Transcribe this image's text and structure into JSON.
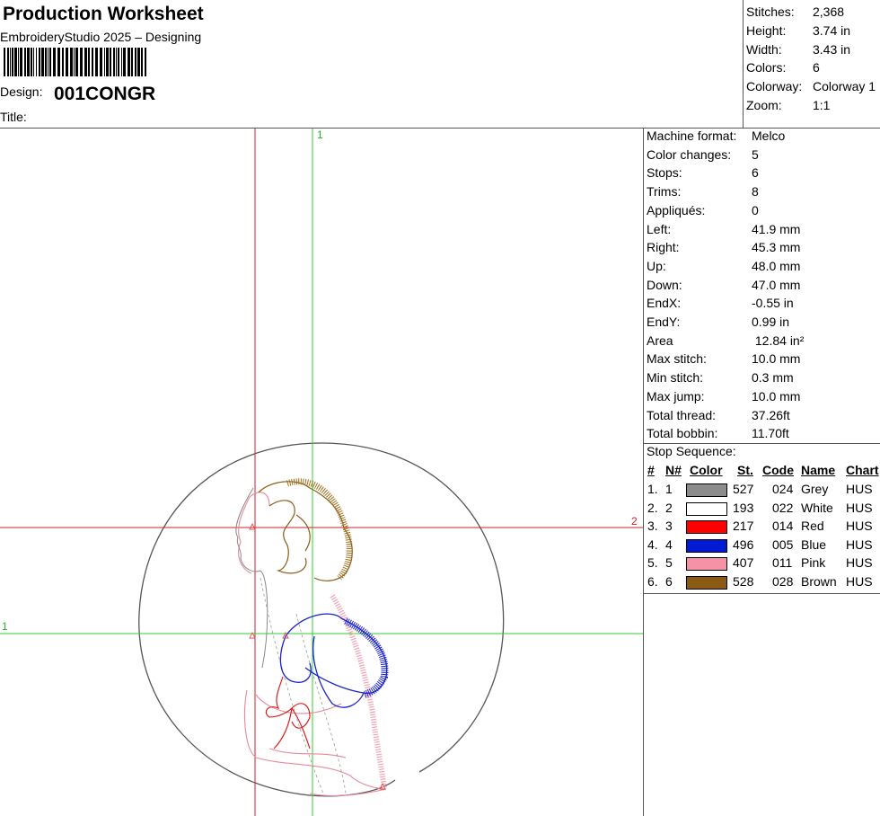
{
  "header": {
    "title": "Production Worksheet",
    "subtitle": "EmbroideryStudio 2025 – Designing",
    "design_label": "Design:",
    "design_value": "001CONGR",
    "title_label": "Title:"
  },
  "summary": [
    {
      "label": "Stitches:",
      "value": "2,368"
    },
    {
      "label": "Height:",
      "value": "3.74 in"
    },
    {
      "label": "Width:",
      "value": "3.43 in"
    },
    {
      "label": "Colors:",
      "value": "6"
    },
    {
      "label": "Colorway:",
      "value": "Colorway 1"
    },
    {
      "label": "Zoom:",
      "value": "1:1"
    }
  ],
  "details": [
    {
      "label": "Machine format:",
      "value": "Melco"
    },
    {
      "label": "Color changes:",
      "value": "5"
    },
    {
      "label": "Stops:",
      "value": "6"
    },
    {
      "label": "Trims:",
      "value": "8"
    },
    {
      "label": "Appliqués:",
      "value": "0"
    },
    {
      "label": "Left:",
      "value": "41.9 mm"
    },
    {
      "label": "Right:",
      "value": "45.3 mm"
    },
    {
      "label": "Up:",
      "value": "48.0 mm"
    },
    {
      "label": "Down:",
      "value": "47.0 mm"
    },
    {
      "label": "EndX:",
      "value": "-0.55 in"
    },
    {
      "label": "EndY:",
      "value": "0.99 in"
    },
    {
      "label": "Area",
      "value": " 12.84 in²"
    },
    {
      "label": "Max stitch:",
      "value": "10.0 mm"
    },
    {
      "label": "Min stitch:",
      "value": "0.3 mm"
    },
    {
      "label": "Max jump:",
      "value": "10.0 mm"
    },
    {
      "label": "Total thread:",
      "value": "37.26ft"
    },
    {
      "label": "Total bobbin:",
      "value": "11.70ft"
    }
  ],
  "stop_sequence": {
    "title": "Stop Sequence:",
    "headers": [
      "#",
      "N#",
      "Color",
      "St.",
      "Code",
      "Name",
      "Chart"
    ],
    "rows": [
      {
        "idx": "1.",
        "n": "1",
        "color": "#8c8c8c",
        "st": "527",
        "code": "024",
        "name": "Grey",
        "chart": "HUS"
      },
      {
        "idx": "2.",
        "n": "2",
        "color": "#ffffff",
        "st": "193",
        "code": "022",
        "name": "White",
        "chart": "HUS"
      },
      {
        "idx": "3.",
        "n": "3",
        "color": "#ff0000",
        "st": "217",
        "code": "014",
        "name": "Red",
        "chart": "HUS"
      },
      {
        "idx": "4.",
        "n": "4",
        "color": "#0019d2",
        "st": "496",
        "code": "005",
        "name": "Blue",
        "chart": "HUS"
      },
      {
        "idx": "5.",
        "n": "5",
        "color": "#f592a5",
        "st": "407",
        "code": "011",
        "name": "Pink",
        "chart": "HUS"
      },
      {
        "idx": "6.",
        "n": "6",
        "color": "#8b5a14",
        "st": "528",
        "code": "028",
        "name": "Brown",
        "chart": "HUS"
      }
    ]
  },
  "guides": {
    "v1_label": "1",
    "h2_label": "2",
    "h1_label": "1"
  }
}
